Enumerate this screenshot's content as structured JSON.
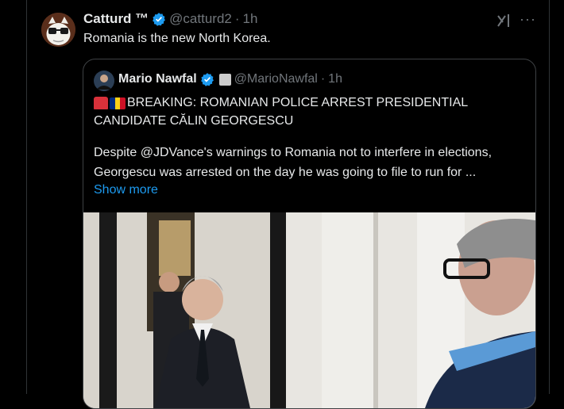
{
  "tweet": {
    "display_name": "Catturd ™",
    "handle": "@catturd2",
    "separator": "·",
    "time": "1h",
    "text": "Romania is the new North Korea."
  },
  "quote": {
    "display_name": "Mario Nawfal",
    "handle": "@MarioNawfal",
    "separator": "·",
    "time": "1h",
    "headline_line1": "BREAKING: ROMANIAN POLICE ARREST PRESIDENTIAL",
    "headline_line2": "CANDIDATE CĂLIN GEORGESCU",
    "body_line1": "Despite @JDVance's warnings to Romania not to interfere in elections,",
    "body_line2": "Georgescu was arrested on the day he was going to file to run for ...",
    "show_more": "Show more"
  },
  "colors": {
    "background": "#000000",
    "text": "#e7e9ea",
    "muted": "#71767b",
    "link": "#1d9bf0",
    "verified": "#1d9bf0",
    "border": "#2f3336"
  },
  "icons": {
    "verified": "verified-badge-icon",
    "grok": "grok-icon",
    "more": "more-dots-icon",
    "siren": "siren-emoji-icon",
    "flag": "romania-flag-icon"
  }
}
